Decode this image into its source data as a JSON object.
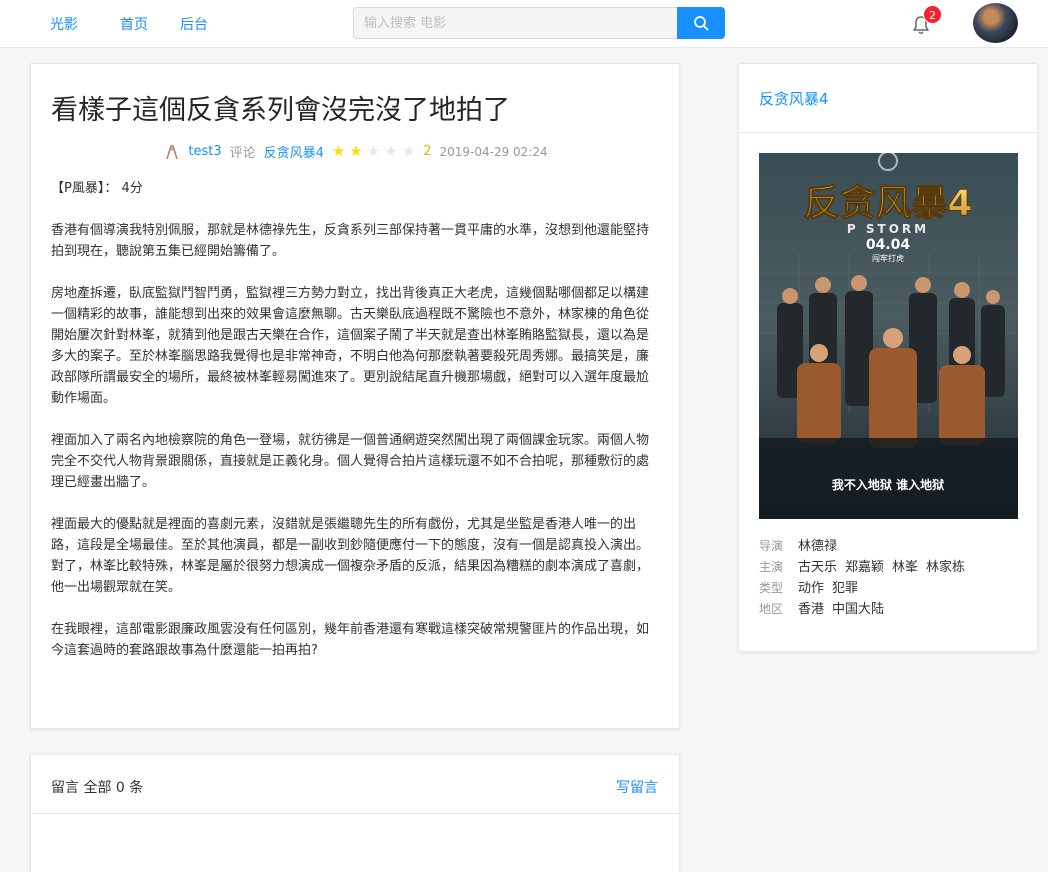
{
  "header": {
    "brand": "光影",
    "nav": [
      "首页",
      "后台"
    ],
    "search_placeholder": "输入搜索 电影",
    "notification_count": "2"
  },
  "review": {
    "title": "看樣子這個反貪系列會沒完沒了地拍了",
    "author": "test3",
    "action": "评论",
    "movie": "反贪风暴4",
    "rating": 2,
    "rating_max": 5,
    "score_text": "2",
    "date": "2019-04-29 02:24",
    "paragraphs": [
      "【P風暴】： 4分",
      "香港有個導演我特別佩服，那就是林德祿先生，反貪系列三部保持著一貫平庸的水準，沒想到他還能堅持拍到現在，聽說第五集已經開始籌備了。",
      "房地產拆遷，臥底監獄鬥智鬥勇，監獄裡三方勢力對立，找出背後真正大老虎，這幾個點哪個都足以構建一個精彩的故事，誰能想到出來的效果會這麼無聊。古天樂臥底過程既不驚險也不意外，林家棟的角色從開始屢次針對林峯，就猜到他是跟古天樂在合作，這個案子鬧了半天就是查出林峯賄賂監獄長，還以為是多大的案子。至於林峯腦思路我覺得也是非常神奇，不明白他為何那麼執著要殺死周秀娜。最搞笑是，廉政部隊所謂最安全的場所，最終被林峯輕易闖進來了。更別說結尾直升機那場戲，絕對可以入選年度最尬動作場面。",
      "裡面加入了兩名內地檢察院的角色一登場，就彷彿是一個普通網遊突然闖出現了兩個課金玩家。兩個人物完全不交代人物背景跟關係，直接就是正義化身。個人覺得合拍片這樣玩還不如不合拍呢，那種敷衍的處理已經畫出牆了。",
      "裡面最大的優點就是裡面的喜劇元素，沒錯就是張繼聰先生的所有戲份，尤其是坐監是香港人唯一的出路，這段是全場最佳。至於其他演員，都是一副收到鈔隨便應付一下的態度，沒有一個是認真投入演出。對了，林峯比較特殊，林峯是屬於很努力想演成一個複杂矛盾的反派，結果因為糟糕的劇本演成了喜劇，他一出場觀眾就在笑。",
      "在我眼裡，這部電影跟廉政風雲没有任何區別，幾年前香港還有寒戰這樣突破常規警匪片的作品出現，如今這套過時的套路跟故事為什麼還能一拍再拍?"
    ]
  },
  "movie": {
    "title": "反贪风暴4",
    "poster": {
      "title": "反贪风暴4",
      "subtitle": "P STORM",
      "date": "04.04",
      "date_caption": "闯牢打虎",
      "tagline": "我不入地狱  谁入地狱"
    },
    "info": [
      {
        "label": "导演",
        "values": [
          "林德禄"
        ]
      },
      {
        "label": "主演",
        "values": [
          "古天乐",
          "郑嘉颖",
          "林峯",
          "林家栋"
        ]
      },
      {
        "label": "类型",
        "values": [
          "动作",
          "犯罪"
        ]
      },
      {
        "label": "地区",
        "values": [
          "香港",
          "中国大陆"
        ]
      }
    ]
  },
  "comments": {
    "title": "留言 全部 0 条",
    "write": "写留言"
  },
  "icons": {
    "search": "search-icon",
    "bell": "bell-icon",
    "author": "user-icon"
  },
  "colors": {
    "accent": "#1890ff",
    "star": "#fadb14",
    "badge": "#f5222d"
  }
}
